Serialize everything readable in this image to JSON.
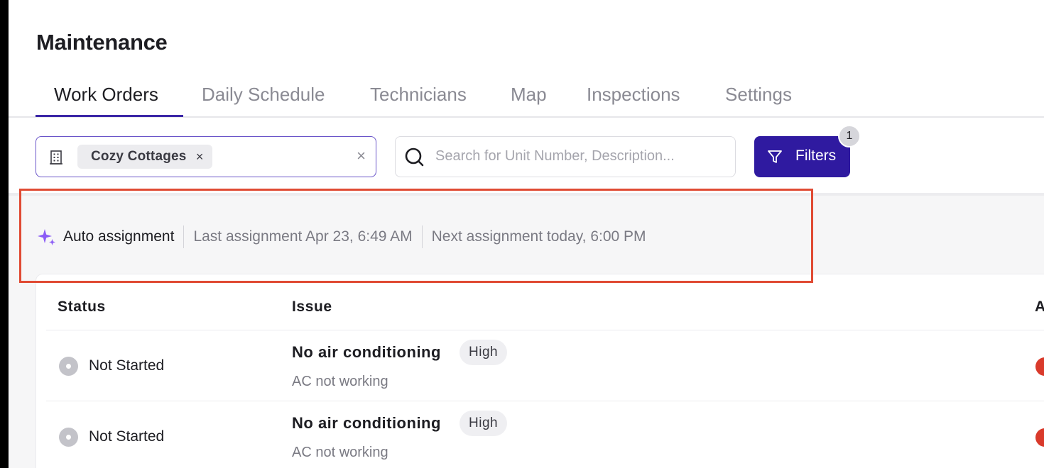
{
  "page": {
    "title": "Maintenance"
  },
  "tabs": [
    {
      "label": "Work Orders",
      "active": true
    },
    {
      "label": "Daily Schedule",
      "active": false
    },
    {
      "label": "Technicians",
      "active": false
    },
    {
      "label": "Map",
      "active": false
    },
    {
      "label": "Inspections",
      "active": false
    },
    {
      "label": "Settings",
      "active": false
    }
  ],
  "toolbar": {
    "property_icon": "building-icon",
    "property_chip": "Cozy Cottages",
    "chip_remove": "×",
    "clear": "×",
    "search_placeholder": "Search for Unit Number, Description...",
    "search_value": "",
    "filters_label": "Filters",
    "filters_count": "1"
  },
  "auto_assignment": {
    "icon": "sparkle-icon",
    "label": "Auto assignment",
    "last": "Last assignment Apr 23, 6:49 AM",
    "next": "Next assignment today, 6:00 PM"
  },
  "table": {
    "columns": [
      "Status",
      "Issue",
      "A"
    ],
    "rows": [
      {
        "status": "Not Started",
        "issue": "No air conditioning",
        "priority": "High",
        "description": "AC not working"
      },
      {
        "status": "Not Started",
        "issue": "No air conditioning",
        "priority": "High",
        "description": "AC not working"
      }
    ]
  },
  "colors": {
    "accent": "#2f1aa0",
    "tab_underline": "#3b26a6",
    "highlight": "#e04a33",
    "sparkle": "#8b5cf6",
    "assignee": "#d93a2b"
  }
}
